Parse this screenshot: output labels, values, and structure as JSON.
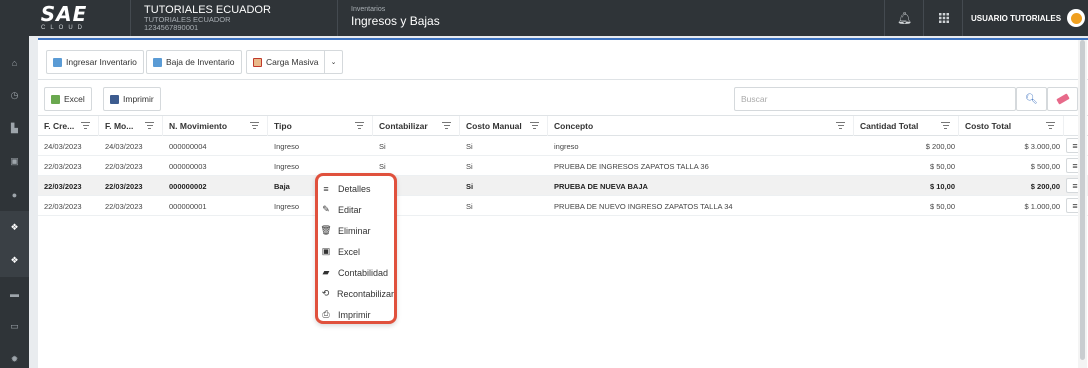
{
  "app": {
    "logo_text": "SAE",
    "logo_sub": "CLOUD",
    "company_name": "TUTORIALES ECUADOR",
    "company_sub": "TUTORIALES ECUADOR",
    "company_ruc": "1234567890001",
    "section_parent": "Inventarios",
    "section_title": "Ingresos y Bajas",
    "user_name": "USUARIO TUTORIALES"
  },
  "toolbar": {
    "ingresar_label": "Ingresar Inventario",
    "baja_label": "Baja de Inventario",
    "carga_label": "Carga Masiva",
    "excel_label": "Excel",
    "imprimir_label": "Imprimir",
    "search_placeholder": "Buscar"
  },
  "table": {
    "columns": [
      "F. Cre...",
      "F. Mo...",
      "N. Movimiento",
      "Tipo",
      "Contabilizar",
      "Costo Manual",
      "Concepto",
      "Cantidad Total",
      "Costo Total"
    ],
    "rows": [
      {
        "fcre": "24/03/2023",
        "fmod": "24/03/2023",
        "nmov": "000000004",
        "tipo": "Ingreso",
        "contab": "Si",
        "costo_manual": "Si",
        "concepto": "ingreso",
        "cantidad": "$ 200,00",
        "costo": "$ 3.000,00"
      },
      {
        "fcre": "22/03/2023",
        "fmod": "22/03/2023",
        "nmov": "000000003",
        "tipo": "Ingreso",
        "contab": "Si",
        "costo_manual": "Si",
        "concepto": "PRUEBA DE INGRESOS ZAPATOS TALLA 36",
        "cantidad": "$ 50,00",
        "costo": "$ 500,00"
      },
      {
        "fcre": "22/03/2023",
        "fmod": "22/03/2023",
        "nmov": "000000002",
        "tipo": "Baja",
        "contab": "",
        "costo_manual": "Si",
        "concepto": "PRUEBA DE NUEVA BAJA",
        "cantidad": "$ 10,00",
        "costo": "$ 200,00"
      },
      {
        "fcre": "22/03/2023",
        "fmod": "22/03/2023",
        "nmov": "000000001",
        "tipo": "Ingreso",
        "contab": "",
        "costo_manual": "Si",
        "concepto": "PRUEBA DE NUEVO INGRESO ZAPATOS TALLA 34",
        "cantidad": "$ 50,00",
        "costo": "$ 1.000,00"
      }
    ]
  },
  "menu": {
    "items": [
      "Detalles",
      "Editar",
      "Eliminar",
      "Excel",
      "Contabilidad",
      "Recontabilizar",
      "Imprimir"
    ]
  },
  "colors": {
    "topbar": "#2f3438",
    "accent": "#3d72c0",
    "highlight_border": "#e0513d"
  }
}
